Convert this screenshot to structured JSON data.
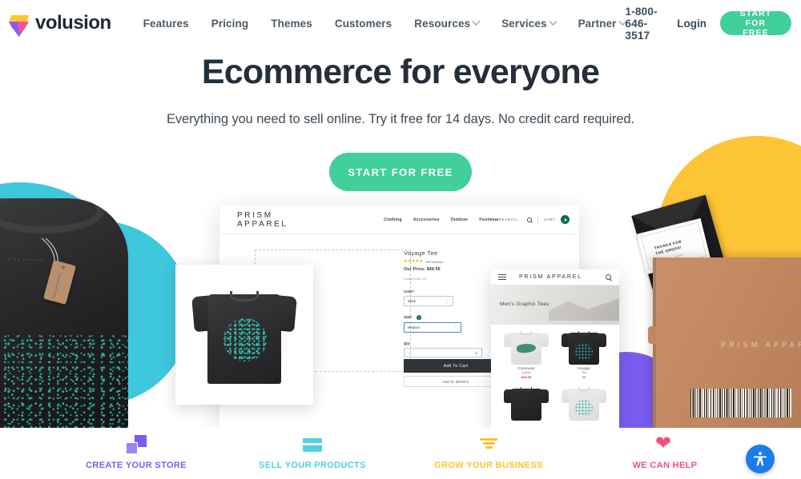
{
  "header": {
    "brand_name": "volusion",
    "nav_items": [
      {
        "label": "Features",
        "has_dropdown": false
      },
      {
        "label": "Pricing",
        "has_dropdown": false
      },
      {
        "label": "Themes",
        "has_dropdown": false
      },
      {
        "label": "Customers",
        "has_dropdown": false
      },
      {
        "label": "Resources",
        "has_dropdown": true
      },
      {
        "label": "Services",
        "has_dropdown": true
      },
      {
        "label": "Partner",
        "has_dropdown": true
      }
    ],
    "phone": "1-800-646-3517",
    "login_label": "Login",
    "cta_label": "START FOR FREE",
    "cta_color": "#41cf9b"
  },
  "hero": {
    "headline": "Ecommerce for everyone",
    "subhead": "Everything you need to sell online. Try it free for 14 days. No credit card required.",
    "cta_label": "START FOR FREE"
  },
  "desktop_mockup": {
    "store_name": "PRISM APPAREL",
    "nav": [
      "Clothing",
      "Accessories",
      "Outdoor",
      "Footwear"
    ],
    "search_label": "SEARCH...",
    "cart_label": "CART",
    "product": {
      "title": "Voyage Tee",
      "stars": "★★★★★",
      "reviews": "240 Reviews",
      "price": "Our Price: $49.95",
      "code": "Product Code: 141",
      "color_label": "Color*:",
      "color_value": "Black",
      "size_label": "Size*:",
      "size_value": "Medium",
      "qty_label": "Qty:",
      "qty_value": "1",
      "add_to_cart": "Add To Cart",
      "add_to_wishlist": "Add To Wishlist"
    }
  },
  "mobile_mockup": {
    "store_name": "PRISM APPAREL",
    "category": "Men's Graphic Tees",
    "products": [
      {
        "name": "Commuter",
        "sub": "subtitle",
        "price": "$29.95"
      },
      {
        "name": "Voyage",
        "sub": "Tee",
        "price": "95"
      },
      {
        "name": "",
        "sub": "",
        "price": ""
      },
      {
        "name": "",
        "sub": "",
        "price": ""
      }
    ]
  },
  "right_photo": {
    "box_label": "PRISM APPAREL",
    "card_line1": "THANKS FOR",
    "card_line2": "THE ORDER!",
    "card_line3": "prism"
  },
  "left_photo": {
    "tag_text": "PRISM APPAREL",
    "collar_text": "PRISM APPAREL"
  },
  "features": [
    {
      "label": "CREATE YOUR STORE",
      "color": "#7b5cf0",
      "icon": "overlapping-squares-icon"
    },
    {
      "label": "SELL YOUR PRODUCTS",
      "color": "#4fd0e0",
      "icon": "credit-card-icon"
    },
    {
      "label": "GROW YOUR BUSINESS",
      "color": "#fcc22e",
      "icon": "bar-chart-icon"
    },
    {
      "label": "WE CAN HELP",
      "color": "#f24f7f",
      "icon": "heart-icon"
    }
  ],
  "accessibility": {
    "label": "accessibility-widget",
    "color": "#1b7ceb"
  }
}
